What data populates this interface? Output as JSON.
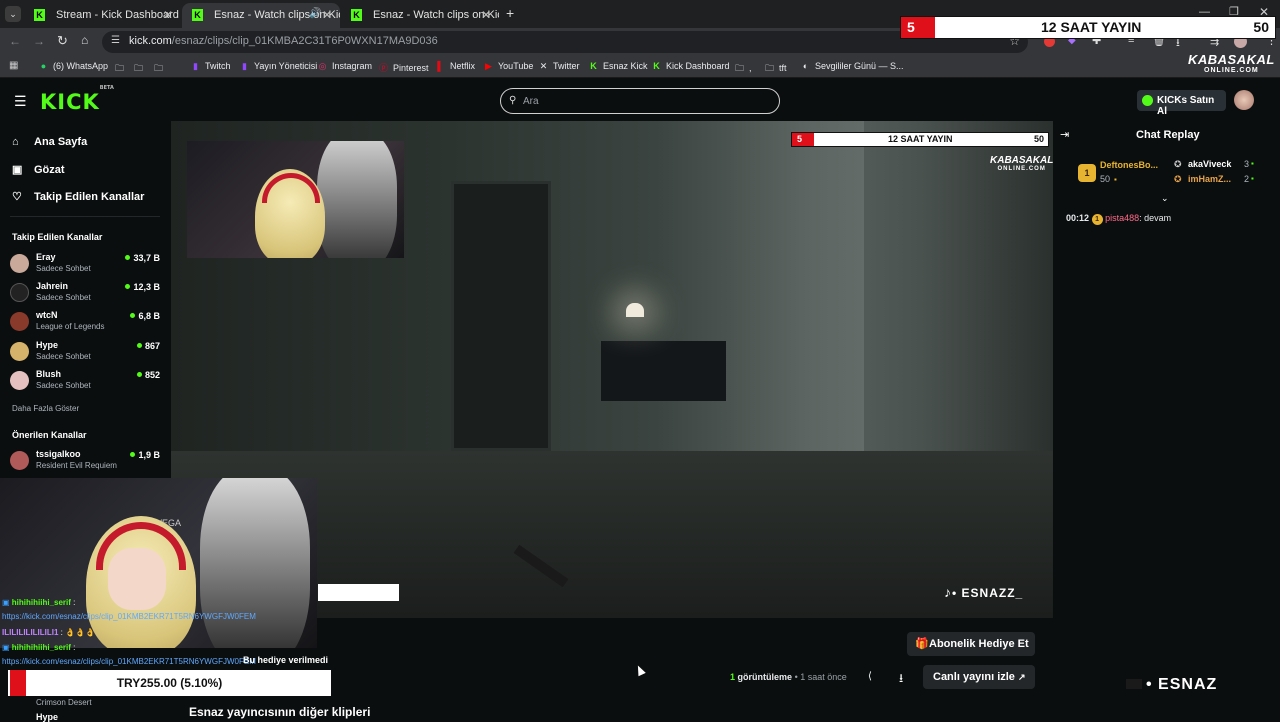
{
  "browser": {
    "tabs": [
      {
        "title": "Stream - Kick Dashboard"
      },
      {
        "title": "Esnaz - Watch clips on Kick"
      },
      {
        "title": "Esnaz - Watch clips on Kick"
      }
    ],
    "url_host": "kick.com",
    "url_path": "/esnaz/clips/clip_01KMBA2C31T6P0WXN17MA9D036",
    "bookmarks": [
      "(6) WhatsApp",
      "Twitch",
      "Yayın Yöneticisi",
      "Instagram",
      "Pinterest",
      "Netflix",
      "YouTube",
      "Twitter",
      "Esnaz Kick",
      "Kick Dashboard",
      "tft",
      "Sevgililer Günü — S..."
    ]
  },
  "overlay_top": {
    "left_num": "5",
    "title": "12 SAAT YAYIN",
    "right_num": "50",
    "brand": "KABASAKAL",
    "brand_sub": "ONLINE.COM"
  },
  "header": {
    "logo": "KICK",
    "logo_tag": "BETA",
    "search_placeholder": "Ara",
    "kicks_button": "KICKs Satın Al"
  },
  "sidebar": {
    "nav": [
      {
        "label": "Ana Sayfa"
      },
      {
        "label": "Gözat"
      },
      {
        "label": "Takip Edilen Kanallar"
      }
    ],
    "followed_heading": "Takip Edilen Kanallar",
    "followed": [
      {
        "name": "Eray",
        "category": "Sadece Sohbet",
        "viewers": "33,7 B"
      },
      {
        "name": "Jahrein",
        "category": "Sadece Sohbet",
        "viewers": "12,3 B"
      },
      {
        "name": "wtcN",
        "category": "League of Legends",
        "viewers": "6,8 B"
      },
      {
        "name": "Hype",
        "category": "Sadece Sohbet",
        "viewers": "867"
      },
      {
        "name": "Blush",
        "category": "Sadece Sohbet",
        "viewers": "852"
      }
    ],
    "show_more": "Daha Fazla Göster",
    "recommended_heading": "Önerilen Kanallar",
    "recommended": [
      {
        "name": "tssigalkoo",
        "category": "Resident Evil Requiem",
        "viewers": "1,9 B"
      }
    ]
  },
  "video": {
    "overlay_left": "5",
    "overlay_title": "12 SAAT YAYIN",
    "overlay_right": "50",
    "brand": "KABASAKAL",
    "brand_sub": "ONLINE.COM",
    "watermark": "• ESNAZZ_"
  },
  "chat": {
    "title": "Chat Replay",
    "leaders": [
      {
        "rank": "1",
        "name": "DeftonesBo...",
        "count": "50"
      },
      {
        "name": "akaViveck",
        "count": "3"
      },
      {
        "name": "imHamZ...",
        "count": "2"
      }
    ],
    "messages": [
      {
        "time": "00:12",
        "badge": "1",
        "user": "pista488",
        "text": ": devam"
      }
    ]
  },
  "below": {
    "gift_button": "Abonelik Hediye Et",
    "views_count": "1",
    "views_label": "görüntüleme",
    "ago": "• 1 saat önce",
    "live_button": "Canlı yayını izle",
    "other_clips": "Esnaz yayıncısının diğer klipleri",
    "overlay_brand": "• ESNAZ"
  },
  "stream_overlay": {
    "chat": [
      {
        "user": "hihihihiihi_serif",
        "text": ":"
      },
      {
        "user": "",
        "text": "https://kick.com/esnaz/clips/clip_01KMB2EKR71T5RN6YWGFJW0FEM"
      },
      {
        "user": "ILILILILILILILI1",
        "text": ": 👌👌👌"
      },
      {
        "user": "hihihihiihi_serif",
        "text": ":"
      },
      {
        "user": "",
        "text": "https://kick.com/esnaz/clips/clip_01KMB2EKR71T5RN6YWGFJW0FEM"
      }
    ],
    "alert": "Bu hediye verilmedi",
    "donation": "TRY255.00 (5.10%)",
    "side_partial": "Crimson Desert",
    "bottom_partial": "Hype"
  }
}
